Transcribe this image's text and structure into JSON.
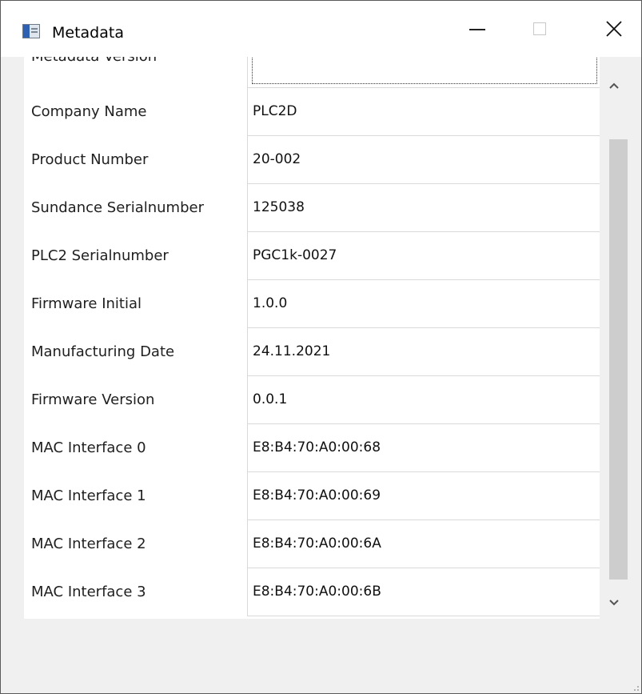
{
  "window": {
    "title": "Metadata"
  },
  "title_icons": {
    "app": "app-window-icon",
    "minimize": "minimize-icon",
    "maximize": "maximize-icon",
    "close": "close-icon"
  },
  "table": {
    "partial_label": "Metadata Version",
    "rows": [
      {
        "label": "Company Name",
        "value": "PLC2D"
      },
      {
        "label": "Product Number",
        "value": "20-002"
      },
      {
        "label": "Sundance Serialnumber",
        "value": "125038"
      },
      {
        "label": "PLC2 Serialnumber",
        "value": "PGC1k-0027"
      },
      {
        "label": "Firmware Initial",
        "value": "1.0.0"
      },
      {
        "label": "Manufacturing Date",
        "value": "24.11.2021"
      },
      {
        "label": "Firmware Version",
        "value": "0.0.1"
      },
      {
        "label": "MAC Interface 0",
        "value": "E8:B4:70:A0:00:68"
      },
      {
        "label": "MAC Interface 1",
        "value": "E8:B4:70:A0:00:69"
      },
      {
        "label": "MAC Interface 2",
        "value": "E8:B4:70:A0:00:6A"
      },
      {
        "label": "MAC Interface 3",
        "value": "E8:B4:70:A0:00:6B"
      }
    ]
  },
  "scrollbar_icons": {
    "up": "chevron-up-icon",
    "down": "chevron-down-icon"
  }
}
